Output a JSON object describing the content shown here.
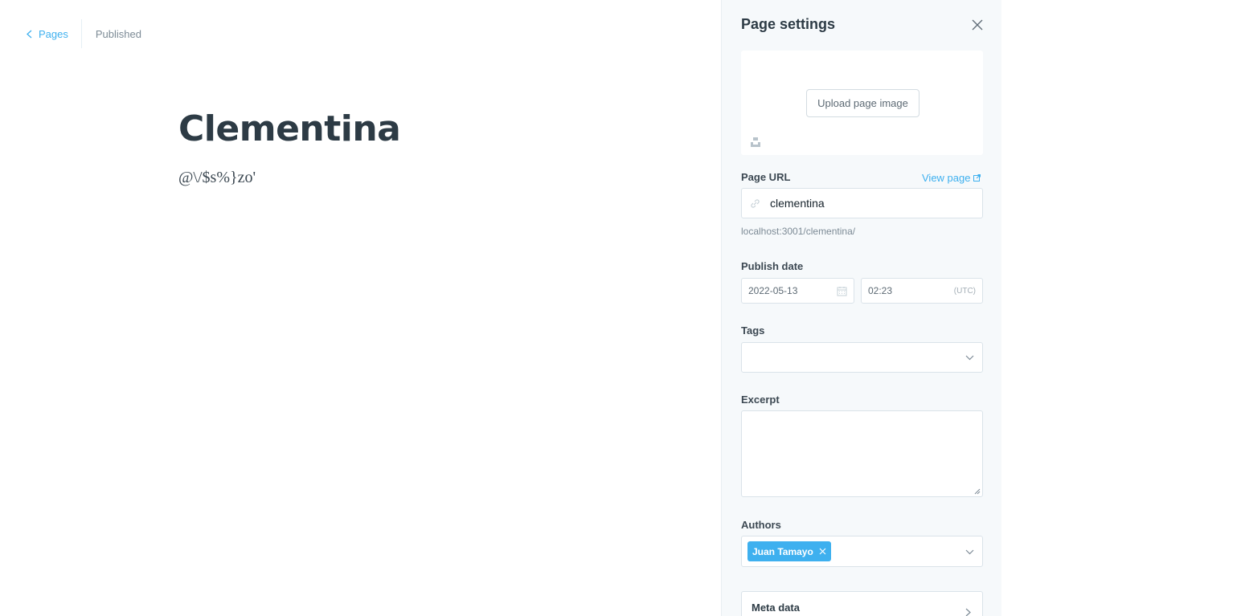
{
  "nav": {
    "back_label": "Pages",
    "status": "Published"
  },
  "editor": {
    "title": "Clementina",
    "body": "@\\/$s%}zo'"
  },
  "settings": {
    "title": "Page settings",
    "upload_label": "Upload page image",
    "url_label": "Page URL",
    "view_page_label": "View page",
    "url_value": "clementina",
    "url_hint": "localhost:3001/clementina/",
    "publish_label": "Publish date",
    "date_value": "2022-05-13",
    "time_value": "02:23",
    "timezone": "(UTC)",
    "tags_label": "Tags",
    "excerpt_label": "Excerpt",
    "excerpt_value": "",
    "authors_label": "Authors",
    "authors": [
      {
        "name": "Juan Tamayo"
      }
    ],
    "meta_label": "Meta data"
  },
  "colors": {
    "accent": "#3eb0ef",
    "panel_bg": "#f6f9fb",
    "title": "#2d3b45",
    "muted": "#7d8b96"
  }
}
